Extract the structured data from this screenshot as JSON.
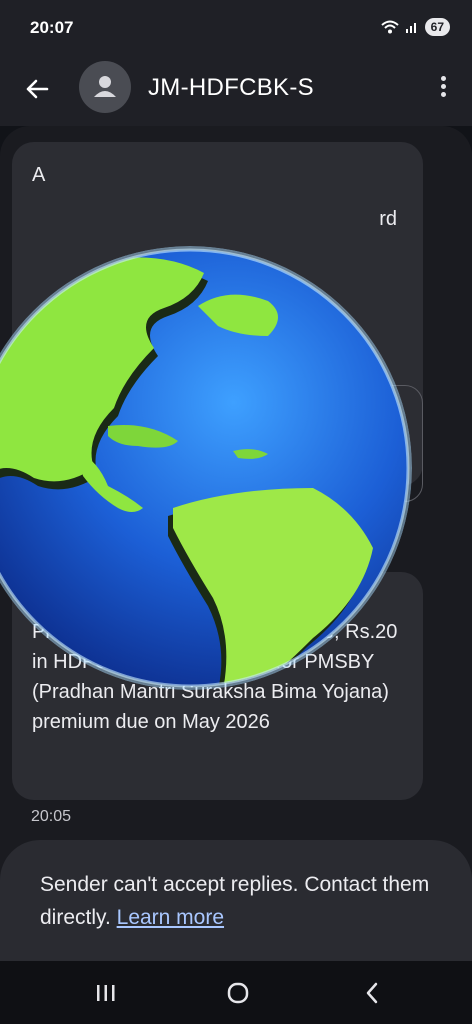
{
  "status_bar": {
    "time": "20:07",
    "battery": "67",
    "wifi_icon": "wifi-icon",
    "signal_icon": "signal-icon"
  },
  "header": {
    "sender": "JM-HDFCBK-S",
    "back_icon": "arrow-left-icon",
    "avatar_icon": "person-icon",
    "menu_icon": "more-vert-icon"
  },
  "messages": [
    {
      "partial_text_start": "A",
      "partial_text_end": "rd"
    },
    {
      "text": "Renewal Due:\nPlease maintain sufficient balance, Rs.20 in HDFC Bank A/c XX0136 for PMSBY (Pradhan Mantri Suraksha Bima Yojana) premium due on May 2026",
      "time": "20:05"
    }
  ],
  "notice": {
    "text": "Sender can't accept replies. Contact them directly.",
    "link": "Learn more"
  },
  "nav": {
    "recents_icon": "recents-icon",
    "home_icon": "home-icon",
    "back_icon": "back-chevron-icon"
  },
  "colors": {
    "background": "#1a1b20",
    "bubble": "#2c2d33",
    "link": "#a9c7ff"
  }
}
